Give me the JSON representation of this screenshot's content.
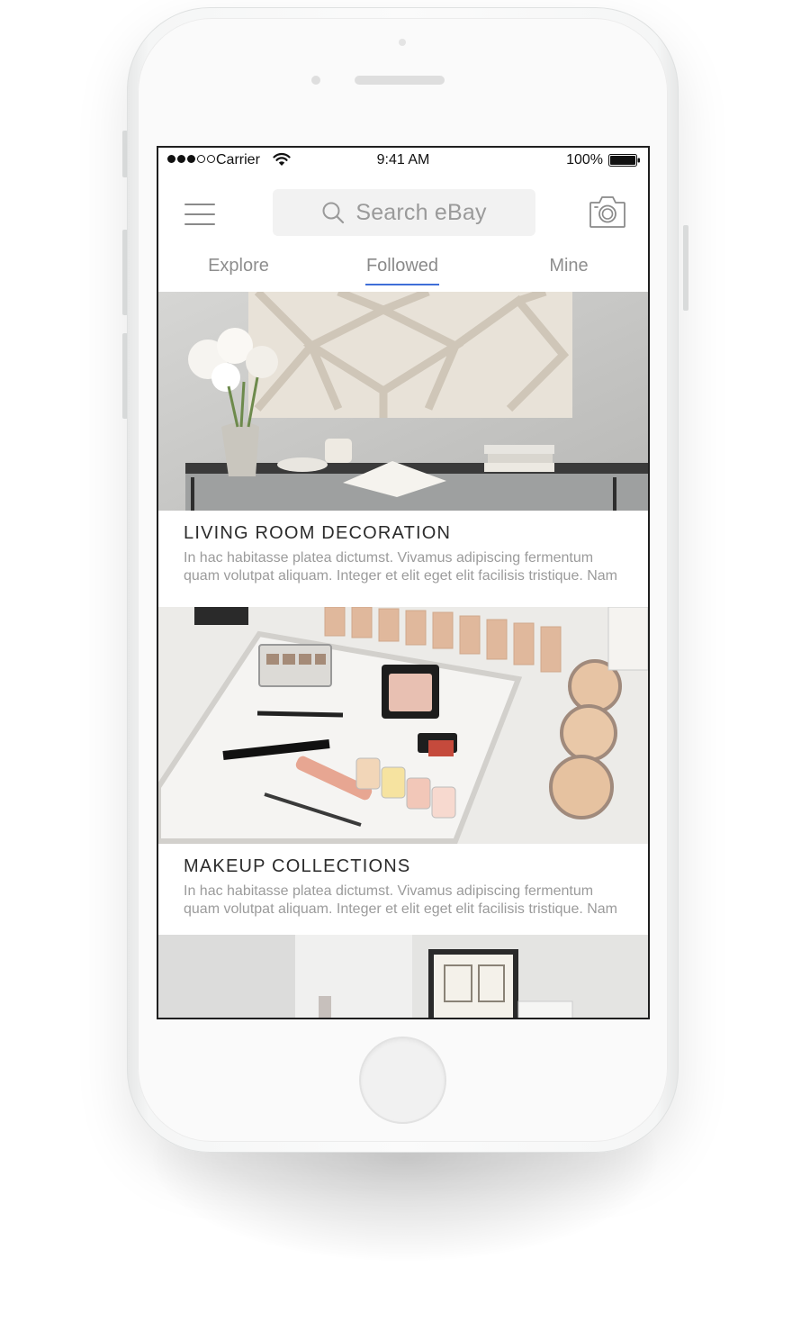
{
  "status_bar": {
    "carrier": "Carrier",
    "time": "9:41 AM",
    "battery": "100%"
  },
  "header": {
    "search_placeholder": "Search eBay",
    "icons": [
      "menu-icon",
      "search-icon",
      "camera-icon"
    ]
  },
  "tabs": [
    {
      "label": "Explore",
      "active": false
    },
    {
      "label": "Followed",
      "active": true
    },
    {
      "label": "Mine",
      "active": false
    }
  ],
  "feed": [
    {
      "title": "LIVING ROOM DECORATION",
      "description": "In hac habitasse platea dictumst. Vivamus adipiscing fermentum quam volutpat aliquam. Integer et elit eget elit facilisis tristique. Nam"
    },
    {
      "title": "MAKEUP COLLECTIONS",
      "description": "In hac habitasse platea dictumst. Vivamus adipiscing fermentum quam volutpat aliquam. Integer et elit eget elit facilisis tristique. Nam"
    }
  ],
  "colors": {
    "accent": "#3f6fd8",
    "tab_text": "#8e8e8e",
    "title_text": "#2b2b2b",
    "description_text": "#9b9b9b"
  }
}
